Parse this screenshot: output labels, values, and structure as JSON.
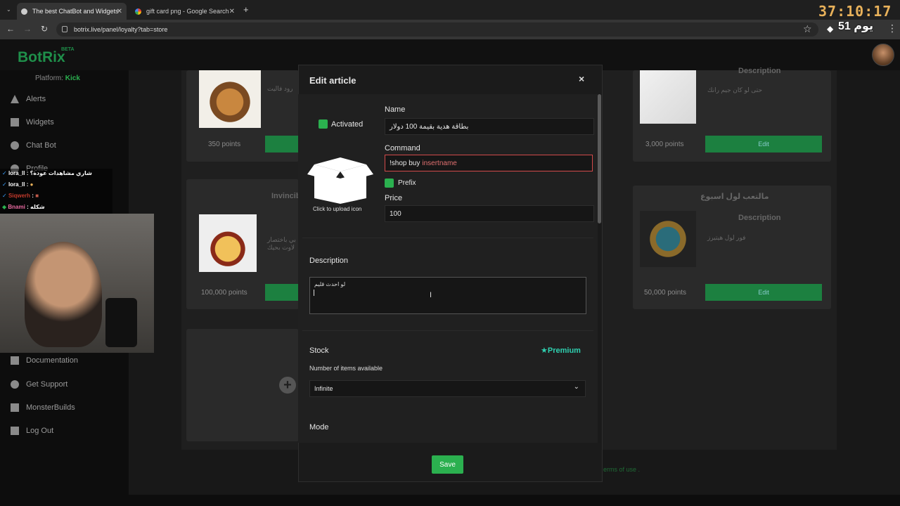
{
  "browser": {
    "tabs": [
      {
        "title": "The best ChatBot and Widgets"
      },
      {
        "title": "gift card png - Google Search"
      }
    ],
    "url": "botrix.live/panel/loyalty?tab=store"
  },
  "overlay": {
    "timer": "37:10:17",
    "day": "يوم 51"
  },
  "app": {
    "logo": "BotRix",
    "logo_badge": "BETA",
    "platform_label": "Platform:",
    "platform_value": "Kick"
  },
  "sidebar": {
    "items_top": [
      {
        "label": "Alerts",
        "icon": "alert-icon"
      },
      {
        "label": "Widgets",
        "icon": "widgets-icon"
      },
      {
        "label": "Chat Bot",
        "icon": "chatbot-icon"
      },
      {
        "label": "Profile",
        "icon": "profile-icon"
      }
    ],
    "items_bottom": [
      {
        "label": "Documentation",
        "icon": "doc-icon"
      },
      {
        "label": "Get Support",
        "icon": "help-icon"
      },
      {
        "label": "MonsterBuilds",
        "icon": "monitor-icon"
      },
      {
        "label": "Log Out",
        "icon": "logout-icon"
      }
    ]
  },
  "store": {
    "cards": [
      {
        "points": "350 points",
        "note": "رود فاليت"
      },
      {
        "points": "3,000 points",
        "desc_title": "Description",
        "note": "حتى لو كان جيم رانك",
        "edit": "Edit"
      },
      {
        "title": "Invincib",
        "points": "100,000 points",
        "note": "بي باختصار لاوت بحيك"
      },
      {
        "title": "مالتعب لول اسبوع",
        "points": "50,000 points",
        "desc_title": "Description",
        "note": "فور لول هيتيرز",
        "edit": "Edit"
      }
    ],
    "footer_text": "erms of use ."
  },
  "chat": {
    "lines": [
      {
        "user": "lora_ll",
        "text": ": شاري مشاهدات عودة؟"
      },
      {
        "user": "lora_ll",
        "text": ":"
      },
      {
        "user": "Siqwerh",
        "text": ":"
      },
      {
        "user": "Bnami",
        "text": ": شكله"
      }
    ]
  },
  "modal": {
    "title": "Edit article",
    "close": "×",
    "activated_label": "Activated",
    "upload_label": "Click to upload icon",
    "name_label": "Name",
    "name_value": "بطاقة هدية بقيمة 100 دولار",
    "command_label": "Command",
    "command_value": "!shop buy",
    "command_suffix": "insertname",
    "prefix_label": "Prefix",
    "price_label": "Price",
    "price_value": "100",
    "description_label": "Description",
    "description_value": "لو احدث قليم",
    "stock_label": "Stock",
    "premium_label": "Premium",
    "stock_sublabel": "Number of items available",
    "stock_value": "Infinite",
    "mode_label": "Mode",
    "save_label": "Save"
  },
  "colors": {
    "accent": "#2bb04f",
    "brand": "#1f8f4a",
    "timer": "#e8b15a",
    "premium": "#2fd0b0"
  }
}
